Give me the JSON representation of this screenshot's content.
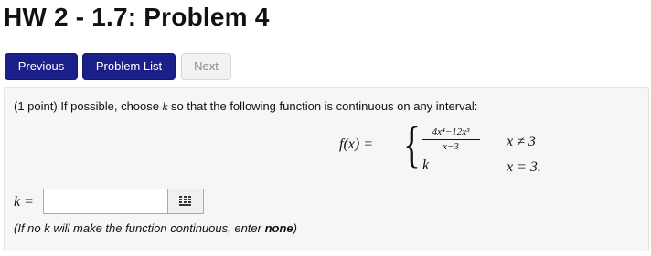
{
  "page": {
    "title": "HW 2 - 1.7: Problem 4"
  },
  "nav": {
    "previous_label": "Previous",
    "problem_list_label": "Problem List",
    "next_label": "Next"
  },
  "problem": {
    "points": "(1 point)",
    "prompt_a": " If possible, choose ",
    "prompt_k": "k",
    "prompt_b": " so that the following function is continuous on any interval:",
    "fx": "f(x) = ",
    "numerator": "4x⁴−12x³",
    "denominator": "x−3",
    "case2_value": "k",
    "cond1": "x ≠ 3",
    "cond2": "x = 3."
  },
  "answer": {
    "label": "k = ",
    "value": "",
    "keypad_icon": "keypad-icon"
  },
  "hint": {
    "prefix": "(If no k will make the function continuous, enter ",
    "bold": "none",
    "suffix": ")"
  }
}
